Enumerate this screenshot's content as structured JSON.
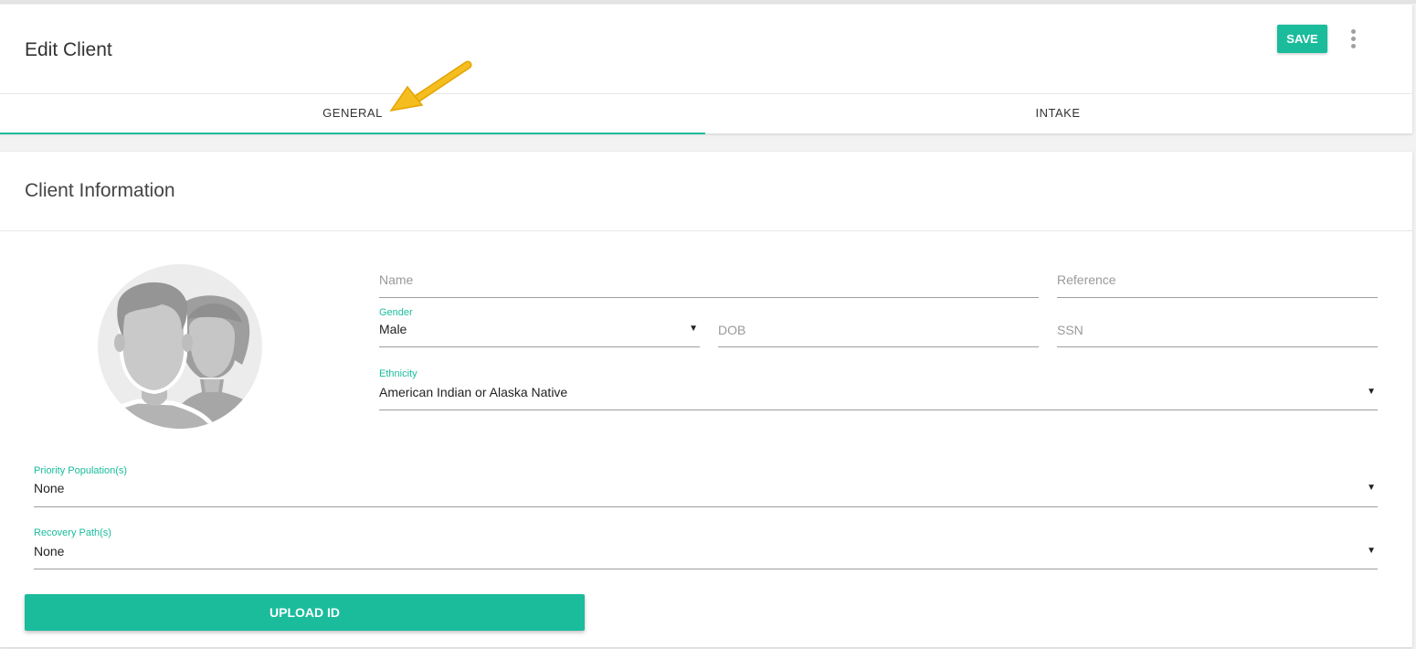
{
  "header": {
    "title": "Edit Client",
    "save_label": "SAVE",
    "more_icon": "more-vert-icon"
  },
  "tabs": [
    {
      "label": "GENERAL",
      "active": true
    },
    {
      "label": "INTAKE",
      "active": false
    }
  ],
  "client_info": {
    "title": "Client Information",
    "avatar_icon": "users-avatar-icon",
    "fields": {
      "name": {
        "placeholder": "Name",
        "value": ""
      },
      "reference": {
        "placeholder": "Reference",
        "value": ""
      },
      "gender": {
        "label": "Gender",
        "value": "Male"
      },
      "dob": {
        "placeholder": "DOB",
        "value": ""
      },
      "ssn": {
        "placeholder": "SSN",
        "value": ""
      },
      "ethnicity": {
        "label": "Ethnicity",
        "value": "American Indian or Alaska Native"
      },
      "priority_population": {
        "label": "Priority Population(s)",
        "value": "None"
      },
      "recovery_path": {
        "label": "Recovery Path(s)",
        "value": "None"
      }
    },
    "upload_label": "UPLOAD ID"
  },
  "colors": {
    "accent": "#1abc9c",
    "arrow": "#f0b400"
  },
  "caret_glyph": "▼"
}
